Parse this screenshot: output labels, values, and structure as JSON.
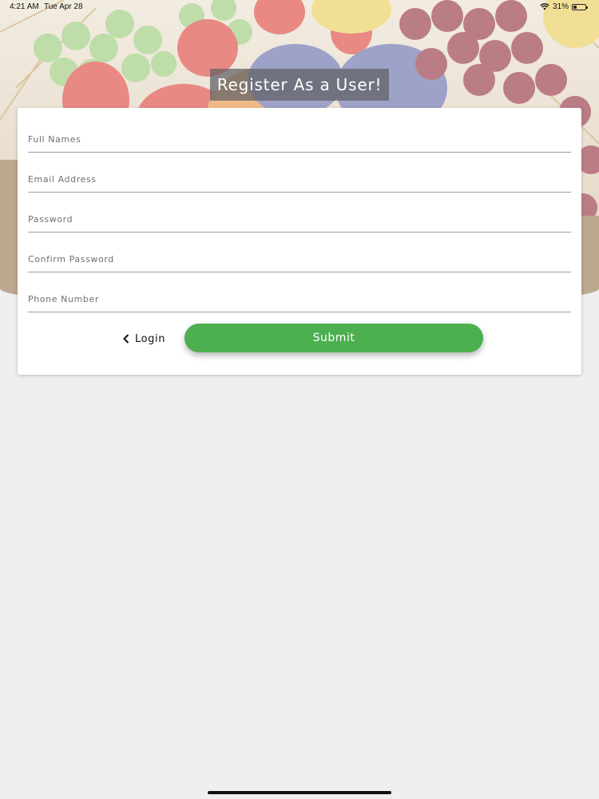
{
  "status_bar": {
    "time": "4:21 AM",
    "date": "Tue Apr 28",
    "battery": "31%",
    "battery_level": 0.31,
    "icons": [
      "wifi-icon",
      "battery-icon"
    ]
  },
  "header": {
    "title": "Register As a User!"
  },
  "form": {
    "fields": [
      {
        "name": "full-names-input",
        "placeholder": "Full Names",
        "value": ""
      },
      {
        "name": "email-address-input",
        "placeholder": "Email Address",
        "value": ""
      },
      {
        "name": "password-input",
        "placeholder": "Password",
        "value": ""
      },
      {
        "name": "confirm-password-input",
        "placeholder": "Confirm Password",
        "value": ""
      },
      {
        "name": "phone-number-input",
        "placeholder": "Phone Number",
        "value": ""
      }
    ],
    "login_label": "Login",
    "submit_label": "Submit"
  },
  "colors": {
    "accent": "#4caf50",
    "background": "#efeff1",
    "card": "#ffffff"
  }
}
